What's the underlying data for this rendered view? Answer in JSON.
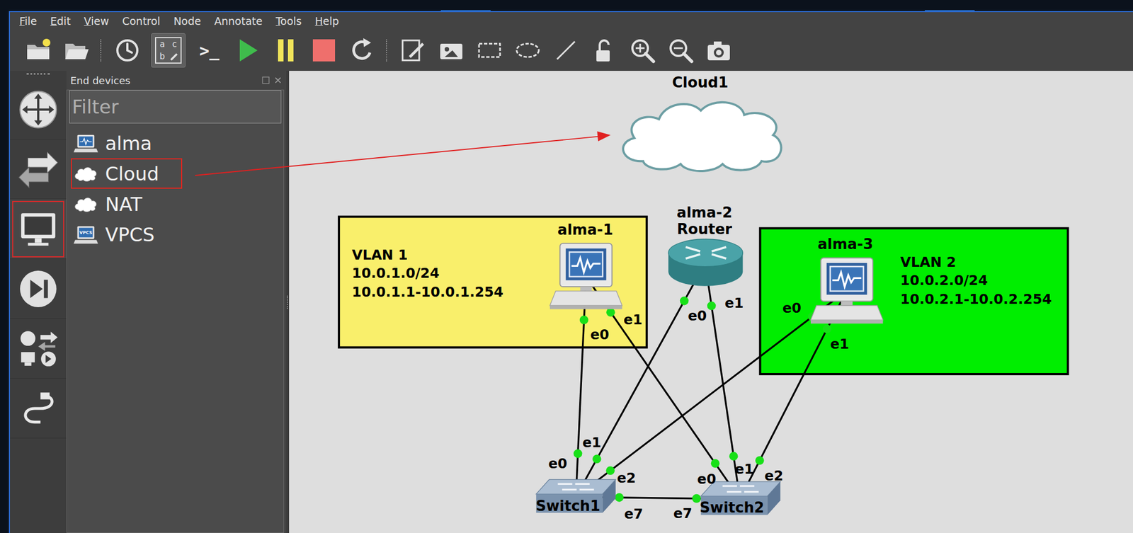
{
  "menu": [
    {
      "label": "File",
      "mnemonic": true
    },
    {
      "label": "Edit",
      "mnemonic": true
    },
    {
      "label": "View",
      "mnemonic": true
    },
    {
      "label": "Control",
      "mnemonic": false
    },
    {
      "label": "Node",
      "mnemonic": false
    },
    {
      "label": "Annotate",
      "mnemonic": false
    },
    {
      "label": "Tools",
      "mnemonic": true
    },
    {
      "label": "Help",
      "mnemonic": true
    }
  ],
  "toolbar": [
    {
      "kind": "new-project",
      "pressed": false
    },
    {
      "kind": "open-project",
      "pressed": false
    },
    {
      "kind": "separator",
      "pressed": false
    },
    {
      "kind": "snapshot",
      "pressed": false
    },
    {
      "kind": "show-labels",
      "letters": [
        "a",
        "c",
        "b"
      ],
      "pressed": true
    },
    {
      "kind": "console",
      "glyph": ">_",
      "pressed": false
    },
    {
      "kind": "start",
      "pressed": false
    },
    {
      "kind": "suspend",
      "pressed": false
    },
    {
      "kind": "stop",
      "pressed": false
    },
    {
      "kind": "reload",
      "pressed": false
    },
    {
      "kind": "separator",
      "pressed": false
    },
    {
      "kind": "add-note",
      "pressed": false
    },
    {
      "kind": "insert-image",
      "pressed": false
    },
    {
      "kind": "rectangle",
      "pressed": false
    },
    {
      "kind": "ellipse",
      "pressed": false
    },
    {
      "kind": "line",
      "pressed": false
    },
    {
      "kind": "lock",
      "pressed": false
    },
    {
      "kind": "zoom-in",
      "pressed": false
    },
    {
      "kind": "zoom-out",
      "pressed": false
    },
    {
      "kind": "screenshot",
      "pressed": false
    }
  ],
  "device_types": [
    {
      "kind": "routers",
      "selected": false,
      "highlighted": false
    },
    {
      "kind": "switches",
      "selected": false,
      "highlighted": false
    },
    {
      "kind": "end-devices",
      "selected": true,
      "highlighted": true
    },
    {
      "kind": "security",
      "selected": false,
      "highlighted": false
    },
    {
      "kind": "all-devices",
      "selected": false,
      "highlighted": false
    },
    {
      "kind": "add-link",
      "selected": false,
      "highlighted": false
    }
  ],
  "panel": {
    "title": "End devices",
    "filter_placeholder": "Filter",
    "items": [
      {
        "name": "alma",
        "kind": "qemu",
        "highlighted": false
      },
      {
        "name": "Cloud",
        "kind": "cloud",
        "highlighted": true
      },
      {
        "name": "NAT",
        "kind": "cloud",
        "highlighted": false
      },
      {
        "name": "VPCS",
        "kind": "vpcs",
        "badge": "VPCS",
        "highlighted": false
      }
    ]
  },
  "canvas": {
    "areas": [
      {
        "title": "VLAN 1",
        "lines": [
          "10.0.1.0/24",
          "10.0.1.1-10.0.1.254"
        ],
        "color": "#f9ef6b"
      },
      {
        "title": "VLAN 2",
        "lines": [
          "10.0.2.0/24",
          "10.0.2.1-10.0.2.254"
        ],
        "color": "#00ee00"
      }
    ],
    "nodes": [
      {
        "name": "Cloud1",
        "kind": "cloud"
      },
      {
        "name": "alma-1",
        "kind": "pc"
      },
      {
        "name": "alma-2",
        "note": "Router",
        "kind": "router"
      },
      {
        "name": "alma-3",
        "kind": "pc"
      },
      {
        "name": "Switch1",
        "kind": "switch"
      },
      {
        "name": "Switch2",
        "kind": "switch"
      }
    ],
    "links": [
      {
        "a": "alma-1",
        "a_port": "e0",
        "b": "Switch1",
        "b_port": "e0",
        "up": true
      },
      {
        "a": "alma-1",
        "a_port": "e1",
        "b": "Switch2",
        "b_port": "e0",
        "up": true
      },
      {
        "a": "alma-2",
        "a_port": "e0",
        "b": "Switch1",
        "b_port": "e1",
        "up": true
      },
      {
        "a": "alma-2",
        "a_port": "e1",
        "b": "Switch2",
        "b_port": "e1",
        "up": true
      },
      {
        "a": "alma-3",
        "a_port": "e0",
        "b": "Switch1",
        "b_port": "e2",
        "up": true
      },
      {
        "a": "alma-3",
        "a_port": "e1",
        "b": "Switch2",
        "b_port": "e2",
        "up": true
      },
      {
        "a": "Switch1",
        "a_port": "e7",
        "b": "Switch2",
        "b_port": "e7",
        "up": true
      }
    ]
  }
}
